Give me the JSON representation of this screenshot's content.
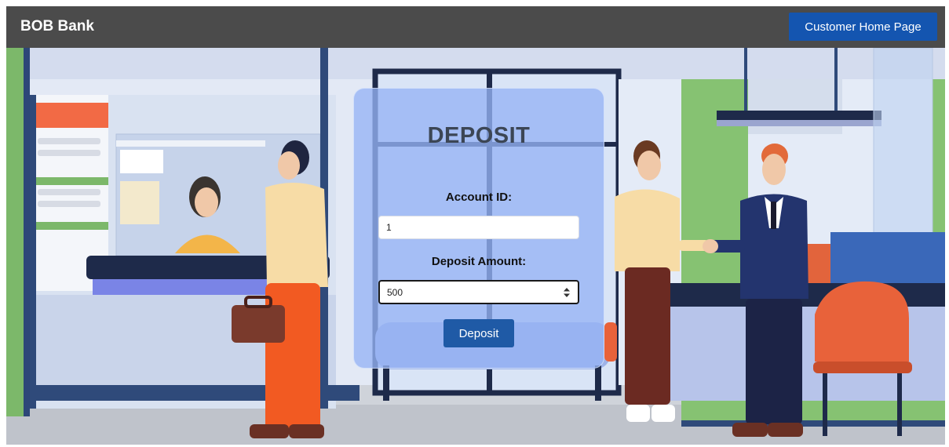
{
  "header": {
    "brand": "BOB Bank",
    "home_button_label": "Customer Home Page",
    "background_color": "#4b4b4b",
    "button_color": "#1455b0"
  },
  "form": {
    "title": "DEPOSIT",
    "account_id_label": "Account ID:",
    "account_id_value": "1",
    "deposit_amount_label": "Deposit Amount:",
    "deposit_amount_value": "500",
    "submit_label": "Deposit"
  },
  "background": {
    "description_icon": "bank-interior-illustration"
  }
}
